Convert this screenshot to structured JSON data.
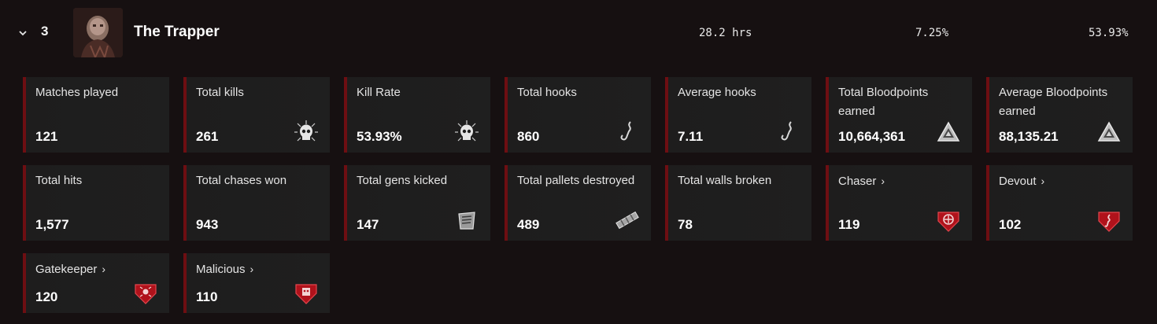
{
  "header": {
    "rank": "3",
    "name": "The Trapper",
    "playtime": "28.2 hrs",
    "pick_rate": "7.25%",
    "kill_rate": "53.93%"
  },
  "stats": [
    {
      "label": "Matches played",
      "value": "121",
      "icon": ""
    },
    {
      "label": "Total kills",
      "value": "261",
      "icon": "skull-icon"
    },
    {
      "label": "Kill Rate",
      "value": "53.93%",
      "icon": "skull-icon"
    },
    {
      "label": "Total hooks",
      "value": "860",
      "icon": "hook-icon"
    },
    {
      "label": "Average hooks",
      "value": "7.11",
      "icon": "hook-icon"
    },
    {
      "label": "Total Bloodpoints earned",
      "value": "10,664,361",
      "icon": "bloodpoints-icon"
    },
    {
      "label": "Average Bloodpoints earned",
      "value": "88,135.21",
      "icon": "bloodpoints-icon"
    },
    {
      "label": "Total hits",
      "value": "1,577",
      "icon": ""
    },
    {
      "label": "Total chases won",
      "value": "943",
      "icon": ""
    },
    {
      "label": "Total gens kicked",
      "value": "147",
      "icon": "generator-icon"
    },
    {
      "label": "Total pallets destroyed",
      "value": "489",
      "icon": "pallet-icon"
    },
    {
      "label": "Total walls broken",
      "value": "78",
      "icon": ""
    },
    {
      "label": "Chaser",
      "value": "119",
      "icon": "chaser-emblem-icon"
    },
    {
      "label": "Devout",
      "value": "102",
      "icon": "devout-emblem-icon"
    },
    {
      "label": "Gatekeeper",
      "value": "120",
      "icon": "gatekeeper-emblem-icon"
    },
    {
      "label": "Malicious",
      "value": "110",
      "icon": "malicious-emblem-icon"
    }
  ]
}
